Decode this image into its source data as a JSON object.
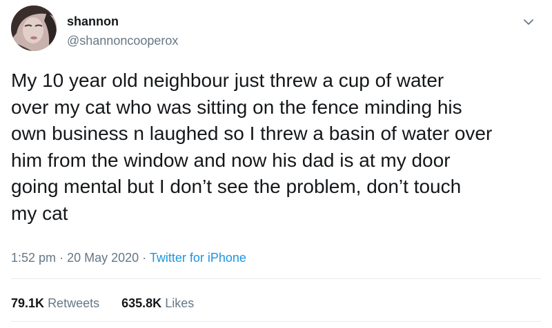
{
  "author": {
    "display_name": "shannon",
    "handle": "@shannoncooperox",
    "avatar_icon": "user-avatar"
  },
  "tweet": {
    "text": "My 10 year old neighbour just threw a cup of water\nover my cat who was sitting on the fence minding his\nown business n laughed so I threw a basin of water over\nhim from the window and now his dad is at my door\ngoing mental but I don’t see the problem, don’t touch\nmy cat",
    "time": "1:52 pm",
    "separator": "·",
    "date": "20 May 2020",
    "source": "Twitter for iPhone"
  },
  "stats": {
    "retweets_count": "79.1K",
    "retweets_label": "Retweets",
    "likes_count": "635.8K",
    "likes_label": "Likes"
  },
  "menu": {
    "icon": "chevron-down-icon"
  },
  "colors": {
    "text": "#14171a",
    "secondary": "#657786",
    "link": "#1b95e0",
    "divider": "#e6ecf0"
  }
}
